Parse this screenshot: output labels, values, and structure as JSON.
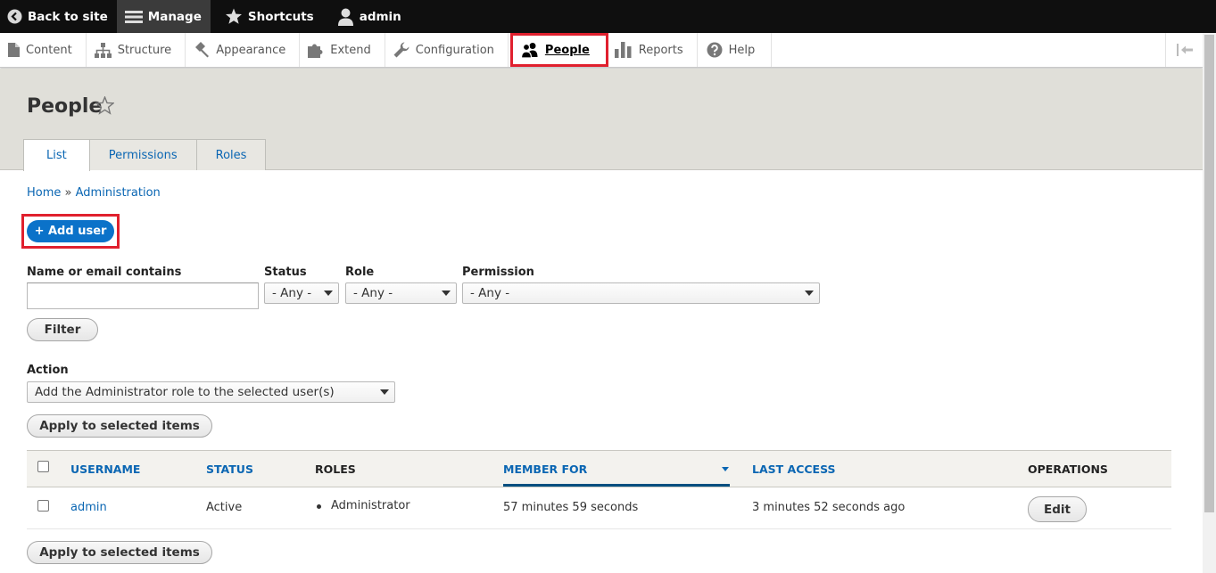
{
  "toolbar": {
    "back_to_site": "Back to site",
    "manage": "Manage",
    "shortcuts": "Shortcuts",
    "user": "admin"
  },
  "tray": {
    "items": [
      "Content",
      "Structure",
      "Appearance",
      "Extend",
      "Configuration",
      "People",
      "Reports",
      "Help"
    ]
  },
  "page": {
    "title": "People",
    "tabs": [
      "List",
      "Permissions",
      "Roles"
    ],
    "breadcrumb": [
      "Home",
      "Administration"
    ],
    "breadcrumb_separator": "»",
    "add_user": "+ Add user"
  },
  "filters": {
    "name_label": "Name or email contains",
    "name_value": "",
    "status_label": "Status",
    "status_value": "- Any -",
    "role_label": "Role",
    "role_value": "- Any -",
    "permission_label": "Permission",
    "permission_value": "- Any -",
    "filter_button": "Filter"
  },
  "action": {
    "label": "Action",
    "value": "Add the Administrator role to the selected user(s)",
    "apply_button": "Apply to selected items"
  },
  "table": {
    "headers": [
      "USERNAME",
      "STATUS",
      "ROLES",
      "MEMBER FOR",
      "LAST ACCESS",
      "OPERATIONS"
    ],
    "rows": [
      {
        "username": "admin",
        "status": "Active",
        "roles": "Administrator",
        "member_for": "57 minutes 59 seconds",
        "last_access": "3 minutes 52 seconds ago",
        "operation": "Edit"
      }
    ]
  },
  "colors": {
    "highlight": "#e0202e",
    "primary": "#0b72c9",
    "link": "#0a66b3"
  }
}
